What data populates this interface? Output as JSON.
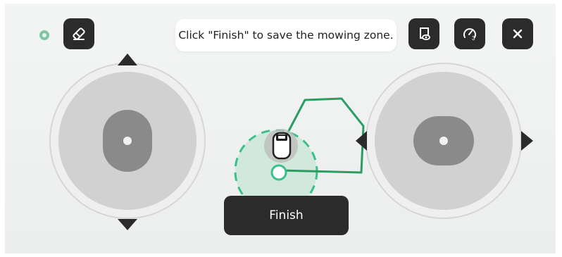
{
  "toolbar": {
    "status_color": "#7fc7a3",
    "eraser_icon": "eraser-icon",
    "eye_icon": "view-toggle-icon",
    "speed_icon": "speed-gauge-icon",
    "speed_level": "3",
    "close_icon": "close-icon"
  },
  "tooltip": {
    "text": "Click \"Finish\" to save the mowing zone."
  },
  "finish_button": {
    "label": "Finish"
  },
  "joysticks": {
    "left": {
      "name": "left-joystick",
      "axis": "vertical"
    },
    "right": {
      "name": "right-joystick",
      "axis": "horizontal"
    }
  },
  "colors": {
    "path": "#2a9d61",
    "mower_zone": "#cfe9dc",
    "dark": "#2b2b2b",
    "pad": "#d1d1d1",
    "knob": "#8a8a8a"
  }
}
